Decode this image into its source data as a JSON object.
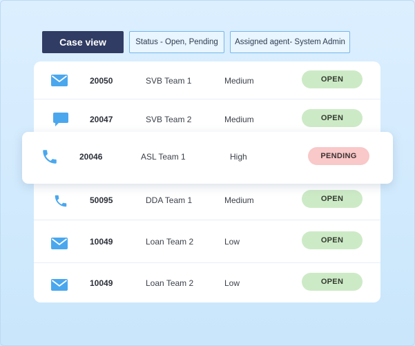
{
  "filters": {
    "case_view_label": "Case view",
    "status_chip": "Status - Open, Pending",
    "agent_chip": "Assigned agent- System Admin"
  },
  "cases": [
    {
      "channel_icon": "mail-icon",
      "id": "20050",
      "team": "SVB Team 1",
      "priority": "Medium",
      "status": "OPEN"
    },
    {
      "channel_icon": "chat-icon",
      "id": "20047",
      "team": "SVB Team 2",
      "priority": "Medium",
      "status": "OPEN"
    },
    {
      "channel_icon": "phone-icon",
      "id": "20046",
      "team": "ASL Team 1",
      "priority": "High",
      "status": "PENDING"
    },
    {
      "channel_icon": "phone-icon",
      "id": "50095",
      "team": "DDA Team 1",
      "priority": "Medium",
      "status": "OPEN"
    },
    {
      "channel_icon": "mail-icon",
      "id": "10049",
      "team": "Loan Team 2",
      "priority": "Low",
      "status": "OPEN"
    },
    {
      "channel_icon": "mail-icon",
      "id": "10049",
      "team": "Loan Team 2",
      "priority": "Low",
      "status": "OPEN"
    }
  ],
  "colors": {
    "accent_dark": "#303c63",
    "icon_blue": "#4aa7ee",
    "open_badge": "#cdeac6",
    "pending_badge": "#f9c8c8"
  }
}
